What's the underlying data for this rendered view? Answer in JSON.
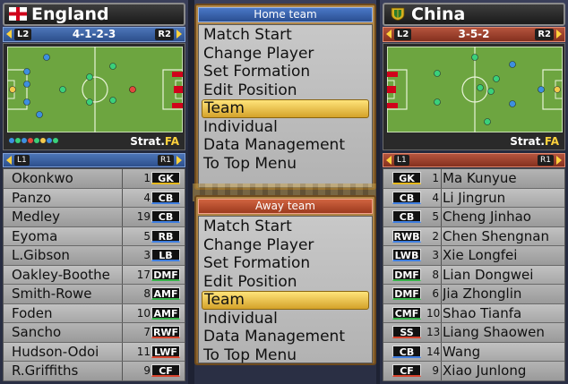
{
  "home": {
    "name": "England",
    "flag_icon": "england-flag-icon",
    "formation": "4-1-2-3",
    "left_button": "L2",
    "right_button": "R2",
    "list_left_button": "L1",
    "list_right_button": "R1",
    "strat_label": "Strat.",
    "strat_value": "FA",
    "players": [
      {
        "name": "Okonkwo",
        "number": "1",
        "position": "GK"
      },
      {
        "name": "Panzo",
        "number": "4",
        "position": "CB"
      },
      {
        "name": "Medley",
        "number": "19",
        "position": "CB"
      },
      {
        "name": "Eyoma",
        "number": "5",
        "position": "RB"
      },
      {
        "name": "L.Gibson",
        "number": "3",
        "position": "LB"
      },
      {
        "name": "Oakley-Boothe",
        "number": "17",
        "position": "DMF"
      },
      {
        "name": "Smith-Rowe",
        "number": "8",
        "position": "AMF"
      },
      {
        "name": "Foden",
        "number": "10",
        "position": "AMF"
      },
      {
        "name": "Sancho",
        "number": "7",
        "position": "RWF"
      },
      {
        "name": "Hudson-Odoi",
        "number": "11",
        "position": "LWF"
      },
      {
        "name": "R.Griffiths",
        "number": "9",
        "position": "CF"
      }
    ]
  },
  "away": {
    "name": "China",
    "flag_icon": "china-crest-icon",
    "formation": "3-5-2",
    "left_button": "L2",
    "right_button": "R2",
    "list_left_button": "L1",
    "list_right_button": "R1",
    "strat_label": "Strat.",
    "strat_value": "FA",
    "players": [
      {
        "name": "Ma Kunyue",
        "number": "1",
        "position": "GK"
      },
      {
        "name": "Li Jingrun",
        "number": "4",
        "position": "CB"
      },
      {
        "name": "Cheng Jinhao",
        "number": "5",
        "position": "CB"
      },
      {
        "name": "Chen Shengnan",
        "number": "2",
        "position": "RWB"
      },
      {
        "name": "Xie Longfei",
        "number": "3",
        "position": "LWB"
      },
      {
        "name": "Lian Dongwei",
        "number": "8",
        "position": "DMF"
      },
      {
        "name": "Jia Zhonglin",
        "number": "6",
        "position": "DMF"
      },
      {
        "name": "Shao Tianfa",
        "number": "10",
        "position": "CMF"
      },
      {
        "name": "Liang Shaowen",
        "number": "13",
        "position": "SS"
      },
      {
        "name": "Wang",
        "number": "14",
        "position": "CB"
      },
      {
        "name": "Xiao Junlong",
        "number": "9",
        "position": "CF"
      }
    ]
  },
  "home_menu": {
    "title": "Home team",
    "items": [
      "Match Start",
      "Change Player",
      "Set Formation",
      "Edit Position",
      "Team",
      "Individual",
      "Data Management",
      "To Top Menu"
    ],
    "selected": "Team"
  },
  "away_menu": {
    "title": "Away team",
    "items": [
      "Match Start",
      "Change Player",
      "Set Formation",
      "Edit Position",
      "Team",
      "Individual",
      "Data Management",
      "To Top Menu"
    ],
    "selected": "Team"
  },
  "colors": {
    "home_accent": "#3d66b0",
    "away_accent": "#a8432b",
    "menu_highlight": "#f2c94c",
    "pitch_green": "#6da540"
  }
}
